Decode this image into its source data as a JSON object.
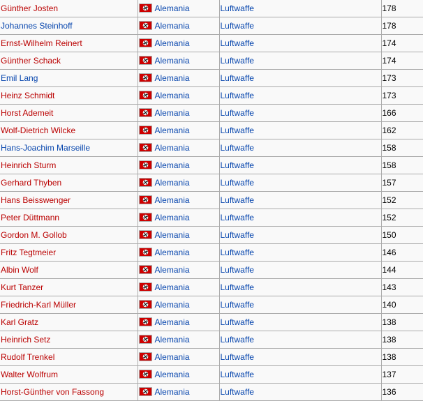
{
  "table": {
    "flag_icon": "nazi-germany-flag",
    "rows": [
      {
        "name": "Günther Josten",
        "name_link": "red",
        "country": "Alemania",
        "branch": "Luftwaffe",
        "kills": "178"
      },
      {
        "name": "Johannes Steinhoff",
        "name_link": "blue",
        "country": "Alemania",
        "branch": "Luftwaffe",
        "kills": "178"
      },
      {
        "name": "Ernst-Wilhelm Reinert",
        "name_link": "red",
        "country": "Alemania",
        "branch": "Luftwaffe",
        "kills": "174"
      },
      {
        "name": "Günther Schack",
        "name_link": "red",
        "country": "Alemania",
        "branch": "Luftwaffe",
        "kills": "174"
      },
      {
        "name": "Emil Lang",
        "name_link": "blue",
        "country": "Alemania",
        "branch": "Luftwaffe",
        "kills": "173"
      },
      {
        "name": "Heinz Schmidt",
        "name_link": "red",
        "country": "Alemania",
        "branch": "Luftwaffe",
        "kills": "173"
      },
      {
        "name": "Horst Ademeit",
        "name_link": "red",
        "country": "Alemania",
        "branch": "Luftwaffe",
        "kills": "166"
      },
      {
        "name": "Wolf-Dietrich Wilcke",
        "name_link": "red",
        "country": "Alemania",
        "branch": "Luftwaffe",
        "kills": "162"
      },
      {
        "name": "Hans-Joachim Marseille",
        "name_link": "blue",
        "country": "Alemania",
        "branch": "Luftwaffe",
        "kills": "158"
      },
      {
        "name": "Heinrich Sturm",
        "name_link": "red",
        "country": "Alemania",
        "branch": "Luftwaffe",
        "kills": "158"
      },
      {
        "name": "Gerhard Thyben",
        "name_link": "red",
        "country": "Alemania",
        "branch": "Luftwaffe",
        "kills": "157"
      },
      {
        "name": "Hans Beisswenger",
        "name_link": "red",
        "country": "Alemania",
        "branch": "Luftwaffe",
        "kills": "152"
      },
      {
        "name": "Peter Düttmann",
        "name_link": "red",
        "country": "Alemania",
        "branch": "Luftwaffe",
        "kills": "152"
      },
      {
        "name": "Gordon M. Gollob",
        "name_link": "red",
        "country": "Alemania",
        "branch": "Luftwaffe",
        "kills": "150"
      },
      {
        "name": "Fritz Tegtmeier",
        "name_link": "red",
        "country": "Alemania",
        "branch": "Luftwaffe",
        "kills": "146"
      },
      {
        "name": "Albin Wolf",
        "name_link": "red",
        "country": "Alemania",
        "branch": "Luftwaffe",
        "kills": "144"
      },
      {
        "name": "Kurt Tanzer",
        "name_link": "red",
        "country": "Alemania",
        "branch": "Luftwaffe",
        "kills": "143"
      },
      {
        "name": "Friedrich-Karl Müller",
        "name_link": "red",
        "country": "Alemania",
        "branch": "Luftwaffe",
        "kills": "140"
      },
      {
        "name": "Karl Gratz",
        "name_link": "red",
        "country": "Alemania",
        "branch": "Luftwaffe",
        "kills": "138"
      },
      {
        "name": "Heinrich Setz",
        "name_link": "red",
        "country": "Alemania",
        "branch": "Luftwaffe",
        "kills": "138"
      },
      {
        "name": "Rudolf Trenkel",
        "name_link": "red",
        "country": "Alemania",
        "branch": "Luftwaffe",
        "kills": "138"
      },
      {
        "name": "Walter Wolfrum",
        "name_link": "red",
        "country": "Alemania",
        "branch": "Luftwaffe",
        "kills": "137"
      },
      {
        "name": "Horst-Günther von Fassong",
        "name_link": "red",
        "country": "Alemania",
        "branch": "Luftwaffe",
        "kills": "136"
      }
    ]
  },
  "colors": {
    "red_link": "#ba0000",
    "blue_link": "#0645ad",
    "border": "#aaaaaa",
    "cell_bg": "#f9f9f9"
  }
}
